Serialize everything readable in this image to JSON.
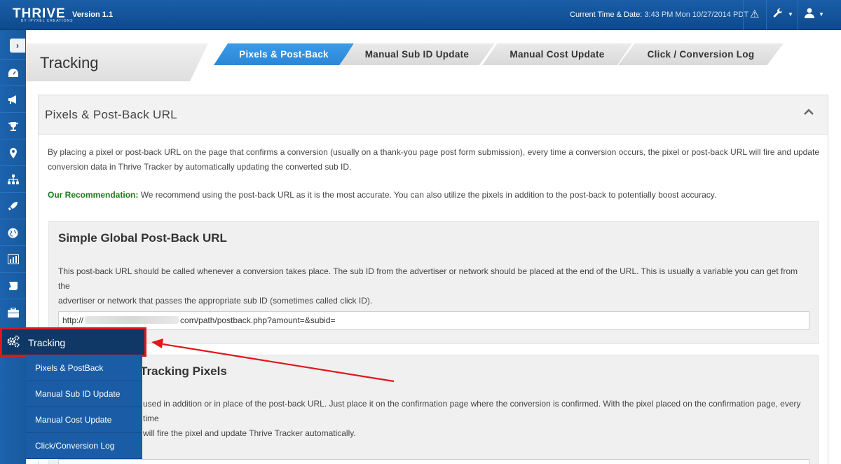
{
  "app": {
    "logo": "THRIVE",
    "logo_sub": "BY IPYXEL CREATIONS",
    "version": "Version 1.1",
    "time_label": "Current Time & Date:",
    "time_value": "3:43 PM Mon 10/27/2014 PDT"
  },
  "icons": {
    "alert": "warning-icon",
    "settings": "wrench-icon",
    "user": "user-icon"
  },
  "sidebar": {
    "items": [
      {
        "icon": "dashboard-icon"
      },
      {
        "icon": "megaphone-icon"
      },
      {
        "icon": "trophy-icon"
      },
      {
        "icon": "map-marker-icon"
      },
      {
        "icon": "sitemap-icon"
      },
      {
        "icon": "rocket-icon"
      },
      {
        "icon": "globe-icon"
      },
      {
        "icon": "bar-chart-icon"
      },
      {
        "icon": "scroll-icon"
      },
      {
        "icon": "briefcase-icon"
      }
    ],
    "tracking_label": "Tracking",
    "submenu": [
      "Pixels & PostBack",
      "Manual Sub ID Update",
      "Manual Cost Update",
      "Click/Conversion Log"
    ]
  },
  "page": {
    "title": "Tracking",
    "tabs": [
      "Pixels & Post-Back",
      "Manual Sub ID Update",
      "Manual Cost Update",
      "Click / Conversion Log"
    ]
  },
  "panel": {
    "title": "Pixels & Post-Back URL",
    "intro_line1": "By placing a pixel or post-back URL on the page that confirms a conversion (usually on a thank-you page post form submission), every time a conversion occurs, the pixel or post-back URL will fire and update",
    "intro_line2": "conversion data in Thrive Tracker by automatically updating the converted sub ID.",
    "rec_label": "Our Recommendation:",
    "rec_text": " We recommend using the post-back URL as it is the most accurate. You can also utilize the pixels in addition to the post-back to potentially boost accuracy.",
    "postback": {
      "title": "Simple Global Post-Back URL",
      "desc_line1": "This post-back URL should be called whenever a conversion takes place. The sub ID from the advertiser or network should be placed at the end of the URL. This is usually a variable you can get from the",
      "desc_line2": "advertiser or network that passes the appropriate sub ID (sometimes called click ID).",
      "url_prefix": "http://",
      "url_suffix": "com/path/postback.php?amount=&subid="
    },
    "pixels": {
      "title_partial": "Tracking Pixels",
      "desc_line1": "used in addition or in place of the post-back URL. Just place it on the confirmation page where the conversion is confirmed. With the pixel placed on the confirmation page, every time",
      "desc_line2": "will fire the pixel and update Thrive Tracker automatically."
    }
  },
  "colors": {
    "topbar": "#1a5ea8",
    "active_tab": "#2b86d6",
    "highlight": "#e0161c",
    "recommendation": "#1b7a1b"
  }
}
